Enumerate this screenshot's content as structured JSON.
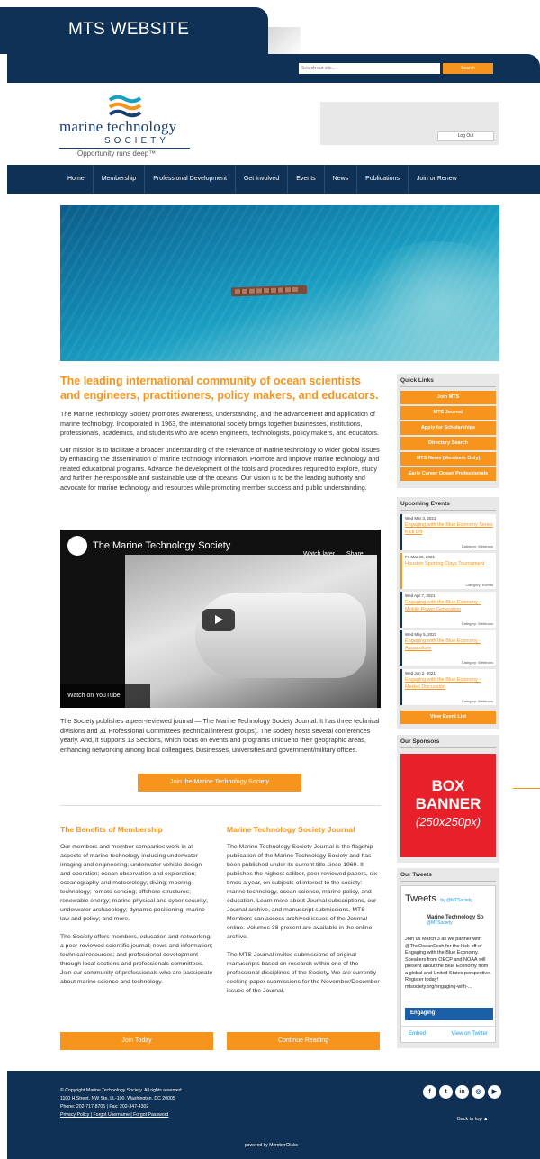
{
  "tab_title": "MTS WEBSITE",
  "search": {
    "placeholder": "Search our site...",
    "button": "Search"
  },
  "logo": {
    "line1": "marine technology",
    "line2": "SOCIETY",
    "tagline": "Opportunity runs deep™"
  },
  "login": {
    "logout": "Log Out"
  },
  "nav": [
    "Home",
    "Membership",
    "Professional Development",
    "Get Involved",
    "Events",
    "News",
    "Publications",
    "Join or Renew"
  ],
  "main": {
    "heading": "The leading international community of ocean scientists and engineers, practitioners, policy makers, and educators.",
    "p1": "The Marine Technology Society promotes awareness, understanding, and the advancement and application of marine technology. Incorporated in 1963, the international society brings together businesses, institutions, professionals, academics, and students who are ocean engineers, technologists, policy makers, and educators.",
    "p2": "Our mission is to facilitate a broader understanding of the relevance of marine technology to wider global issues by enhancing the dissemination of marine technology information. Promote and improve marine technology and related educational programs. Advance the development of the tools and procedures required to explore, study and further the responsible and sustainable use of the oceans. Our vision is to be the leading authority and advocate for marine technology and resources while promoting member success and public understanding.",
    "video": {
      "title": "The Marine Technology Society",
      "watch_later": "Watch later",
      "share": "Share",
      "watch_on": "Watch on YouTube"
    },
    "p3": "The Society publishes a peer-reviewed journal — The Marine Technology Society Journal. It has three technical divisions and 31 Professional Committees (technical interest groups). The society hosts several conferences yearly. And, it supports 13 Sections, which focus on events and programs unique to their geographic areas, enhancing networking among local colleagues, businesses, universities and government/military offices.",
    "join_button": "Join the Marine Technology Society"
  },
  "benefits": {
    "title": "The Benefits of Membership",
    "p1": "Our members and member companies work in all aspects of marine technology including underwater imaging and engineering; underwater vehicle design and operation; ocean observation and exploration; oceanography and meteorology; diving; mooring technology; remote sensing; offshore structures; renewable energy; marine physical and cyber security; underwater archaeology; dynamic positioning; marine law and policy; and more.",
    "p2": "The Society offers members, education and networking; a peer-reviewed scientific journal; news and information; technical resources; and professional development through local sections and professionals committees. Join our community of professionals who are passionate about marine science and technology.",
    "button": "Join Today"
  },
  "journal": {
    "title": "Marine Technology Society Journal",
    "p1": "The Marine Technology Society Journal is the flagship publication of the Marine Technology Society and has been published under its current title since 1969. It publishes the highest caliber, peer-reviewed papers, six times a year, on subjects of interest to the society: marine technology, ocean science, marine policy, and education. Learn more about Journal subscriptions, our Journal archive, and manuscript submissions. MTS Members can access archived issues of the Journal online. Volumes 38-present are available in the online archive.",
    "p2": "The MTS Journal invites submissions of original manuscripts based on research within one of the professional disciplines of the Society. We are currently seeking paper submissions for the November/December issues of the Journal.",
    "button": "Continue Reading"
  },
  "quick_links": {
    "title": "Quick Links",
    "items": [
      "Join MTS",
      "MTS Journal",
      "Apply for Scholarships",
      "Directory Search",
      "MTS News (Members Only)",
      "Early Career Ocean Professionals"
    ]
  },
  "events": {
    "title": "Upcoming Events",
    "items": [
      {
        "date": "Wed Mar 3, 2021",
        "title": "Engaging with the Blue Economy Series Kick Off",
        "category": "Category: Webinars"
      },
      {
        "date": "Fri Mar 26, 2021",
        "title": "Houston Sporting Clays Tournament",
        "category": "Category: Events"
      },
      {
        "date": "Wed Apr 7, 2021",
        "title": "Engaging with the Blue Economy - Mobile Power Generation",
        "category": "Category: Webinars"
      },
      {
        "date": "Wed May 5, 2021",
        "title": "Engaging with the Blue Economy - Aquaculture",
        "category": "Category: Webinars"
      },
      {
        "date": "Wed Jun 2, 2021",
        "title": "Engaging with the Blue Economy - Market Discussion",
        "category": "Category: Webinars"
      }
    ],
    "view_all": "View Event List"
  },
  "sponsors": {
    "title": "Our Sponsors",
    "box1": "BOX",
    "box2": "BANNER",
    "box3": "(250x250px)"
  },
  "tweets": {
    "title": "Our Tweets",
    "widget_title": "Tweets",
    "by": "by @MTSociety",
    "account": "Marine Technology So",
    "handle": "@MTSociety",
    "text": "Join us March 3 as we partner with @TheOceanExch for the kick-off of Engaging with the Blue Economy. Speakers from OECP and NOAA will present about the Blue Economy from a global and United States perspective. Register today! mtsociety.org/engaging-with-...",
    "card": "Engaging",
    "embed": "Embed",
    "view": "View on Twitter"
  },
  "footer": {
    "copyright": "© Copyright Marine Technology Society. All rights reserved.",
    "address": "1100 H Street, NW Ste. LL-100, Washington, DC 20005",
    "phone": "Phone: 202-717-8705 | Fax: 202-347-4302",
    "links": "Privacy Policy | Forgot Username | Forgot Password",
    "back_to_top": "Back to top",
    "powered": "powered by MemberClicks"
  }
}
